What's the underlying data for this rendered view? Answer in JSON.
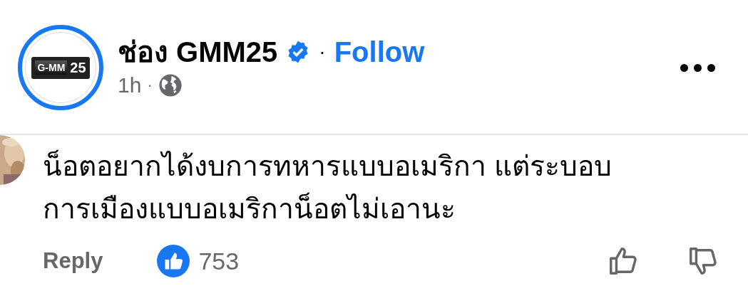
{
  "post_header": {
    "avatar_logo": [
      "G-MM",
      "25"
    ],
    "page_name": "ช่อง GMM25",
    "verified": true,
    "follow_label": "Follow",
    "separator": "·",
    "time": "1h",
    "time_separator": "·"
  },
  "comment": {
    "text": "น็อตอยากได้งบการทหารแบบอเมริกา แต่ระบอบการเมืองแบบอเมริกาน็อตไม่เอานะ",
    "reply_label": "Reply",
    "like_count": "753",
    "liked": false,
    "disliked": false
  }
}
